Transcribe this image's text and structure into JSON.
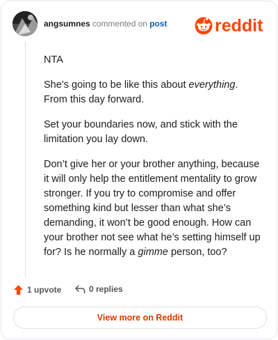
{
  "comment": {
    "username": "angsumnes",
    "action_text": "commented on",
    "post_link": "post",
    "paragraphs": [
      {
        "segments": [
          {
            "text": "NTA",
            "italic": false
          }
        ]
      },
      {
        "segments": [
          {
            "text": "She’s going to be like this about ",
            "italic": false
          },
          {
            "text": "everything",
            "italic": true
          },
          {
            "text": ". From this day forward.",
            "italic": false
          }
        ]
      },
      {
        "segments": [
          {
            "text": "Set your boundaries now, and stick with the limitation you lay down.",
            "italic": false
          }
        ]
      },
      {
        "segments": [
          {
            "text": "Don’t give her or your brother anything, because it will only help the entitlement mentality to grow stronger. If you try to compromise and offer something kind but lesser than what she’s demanding, it won’t be good enough. How can your brother not see what he’s setting himself up for? Is he normally a ",
            "italic": false
          },
          {
            "text": "gimme",
            "italic": true
          },
          {
            "text": " person, too?",
            "italic": false
          }
        ]
      }
    ],
    "upvotes": "1 upvote",
    "replies": "0 replies"
  },
  "brand": {
    "name": "reddit",
    "color": "#ff4500"
  },
  "footer": {
    "view_more": "View more on Reddit"
  },
  "colors": {
    "accent": "#ff4500",
    "link": "#0a5fb0",
    "view_more": "#d93900"
  }
}
